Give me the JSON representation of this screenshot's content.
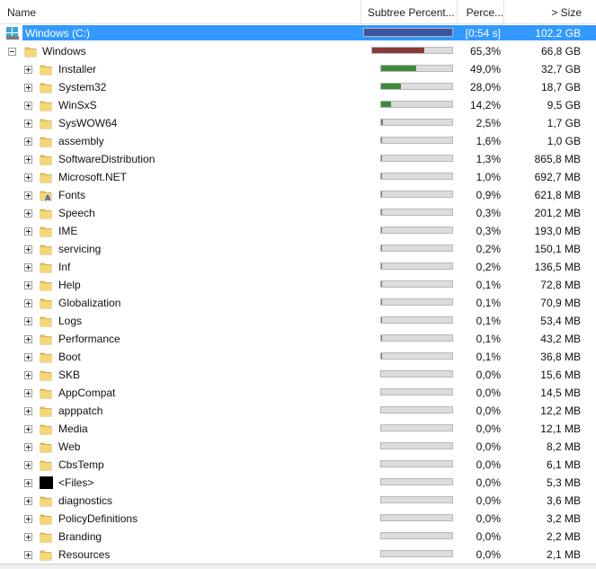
{
  "header": {
    "name": "Name",
    "subtree": "Subtree Percent...",
    "percent": "Perce...",
    "size": "> Size"
  },
  "colors": {
    "selection": "#3399ff",
    "bar_root": "#3d55a0",
    "bar_windows": "#8b3a3a",
    "bar_child": "#3d8b3d",
    "bar_track": "#dcdcdc"
  },
  "rows": [
    {
      "name": "Windows (C:)",
      "percent": "[0:54 s]",
      "size": "102,2 GB",
      "bar": 1.0,
      "level": 0,
      "icon": "drive-icon",
      "selected": true
    },
    {
      "name": "Windows",
      "percent": "65,3%",
      "size": "66,8 GB",
      "bar": 0.653,
      "level": 1,
      "icon": "folder-icon",
      "expanded": true
    },
    {
      "name": "Installer",
      "percent": "49,0%",
      "size": "32,7 GB",
      "bar": 0.49,
      "level": 2,
      "icon": "folder-icon"
    },
    {
      "name": "System32",
      "percent": "28,0%",
      "size": "18,7 GB",
      "bar": 0.28,
      "level": 2,
      "icon": "folder-icon"
    },
    {
      "name": "WinSxS",
      "percent": "14,2%",
      "size": "9,5 GB",
      "bar": 0.142,
      "level": 2,
      "icon": "folder-icon"
    },
    {
      "name": "SysWOW64",
      "percent": "2,5%",
      "size": "1,7 GB",
      "bar": 0.025,
      "level": 2,
      "icon": "folder-icon"
    },
    {
      "name": "assembly",
      "percent": "1,6%",
      "size": "1,0 GB",
      "bar": 0.016,
      "level": 2,
      "icon": "folder-icon"
    },
    {
      "name": "SoftwareDistribution",
      "percent": "1,3%",
      "size": "865,8 MB",
      "bar": 0.013,
      "level": 2,
      "icon": "folder-icon"
    },
    {
      "name": "Microsoft.NET",
      "percent": "1,0%",
      "size": "692,7 MB",
      "bar": 0.01,
      "level": 2,
      "icon": "folder-icon"
    },
    {
      "name": "Fonts",
      "percent": "0,9%",
      "size": "621,8 MB",
      "bar": 0.009,
      "level": 2,
      "icon": "fonts-folder-icon"
    },
    {
      "name": "Speech",
      "percent": "0,3%",
      "size": "201,2 MB",
      "bar": 0.003,
      "level": 2,
      "icon": "folder-icon"
    },
    {
      "name": "IME",
      "percent": "0,3%",
      "size": "193,0 MB",
      "bar": 0.003,
      "level": 2,
      "icon": "folder-icon"
    },
    {
      "name": "servicing",
      "percent": "0,2%",
      "size": "150,1 MB",
      "bar": 0.002,
      "level": 2,
      "icon": "folder-icon"
    },
    {
      "name": "Inf",
      "percent": "0,2%",
      "size": "136,5 MB",
      "bar": 0.002,
      "level": 2,
      "icon": "folder-icon"
    },
    {
      "name": "Help",
      "percent": "0,1%",
      "size": "72,8 MB",
      "bar": 0.001,
      "level": 2,
      "icon": "folder-icon"
    },
    {
      "name": "Globalization",
      "percent": "0,1%",
      "size": "70,9 MB",
      "bar": 0.001,
      "level": 2,
      "icon": "folder-icon"
    },
    {
      "name": "Logs",
      "percent": "0,1%",
      "size": "53,4 MB",
      "bar": 0.001,
      "level": 2,
      "icon": "folder-icon"
    },
    {
      "name": "Performance",
      "percent": "0,1%",
      "size": "43,2 MB",
      "bar": 0.001,
      "level": 2,
      "icon": "folder-icon"
    },
    {
      "name": "Boot",
      "percent": "0,1%",
      "size": "36,8 MB",
      "bar": 0.001,
      "level": 2,
      "icon": "folder-icon"
    },
    {
      "name": "SKB",
      "percent": "0,0%",
      "size": "15,6 MB",
      "bar": 0,
      "level": 2,
      "icon": "folder-icon"
    },
    {
      "name": "AppCompat",
      "percent": "0,0%",
      "size": "14,5 MB",
      "bar": 0,
      "level": 2,
      "icon": "folder-icon"
    },
    {
      "name": "apppatch",
      "percent": "0,0%",
      "size": "12,2 MB",
      "bar": 0,
      "level": 2,
      "icon": "folder-icon"
    },
    {
      "name": "Media",
      "percent": "0,0%",
      "size": "12,1 MB",
      "bar": 0,
      "level": 2,
      "icon": "folder-icon"
    },
    {
      "name": "Web",
      "percent": "0,0%",
      "size": "8,2 MB",
      "bar": 0,
      "level": 2,
      "icon": "folder-icon"
    },
    {
      "name": "CbsTemp",
      "percent": "0,0%",
      "size": "6,1 MB",
      "bar": 0,
      "level": 2,
      "icon": "folder-icon"
    },
    {
      "name": "<Files>",
      "percent": "0,0%",
      "size": "5,3 MB",
      "bar": 0,
      "level": 2,
      "icon": "files-icon"
    },
    {
      "name": "diagnostics",
      "percent": "0,0%",
      "size": "3,6 MB",
      "bar": 0,
      "level": 2,
      "icon": "folder-icon"
    },
    {
      "name": "PolicyDefinitions",
      "percent": "0,0%",
      "size": "3,2 MB",
      "bar": 0,
      "level": 2,
      "icon": "folder-icon"
    },
    {
      "name": "Branding",
      "percent": "0,0%",
      "size": "2,2 MB",
      "bar": 0,
      "level": 2,
      "icon": "folder-icon"
    },
    {
      "name": "Resources",
      "percent": "0,0%",
      "size": "2,1 MB",
      "bar": 0,
      "level": 2,
      "icon": "folder-icon"
    }
  ]
}
